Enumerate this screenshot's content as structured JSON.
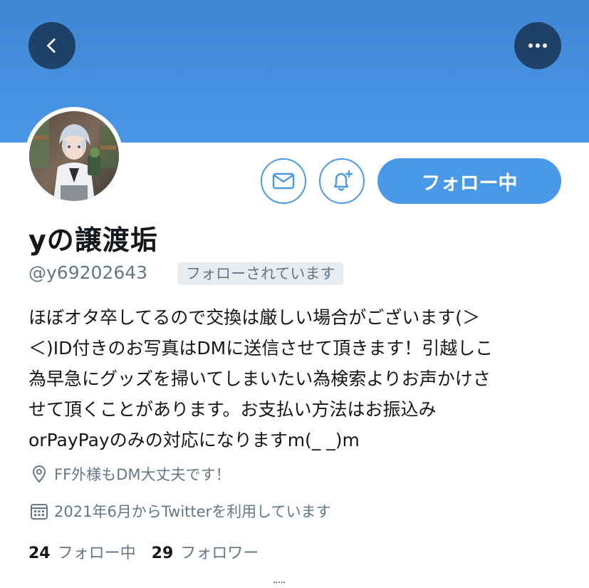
{
  "header": {
    "back_icon": "chevron-left-icon",
    "more_icon": "more-horizontal-icon",
    "banner_color": "#4a97e6"
  },
  "profile": {
    "display_name": "yの譲渡垢",
    "handle": "@y69202643",
    "follows_you_badge": "フォローされています",
    "bio": "ほぼオタ卒してるので交換は厳しい場合がございます(＞\n＜)ID付きのお写真はDMに送信させて頂きます！引越しこ\n為早急にグッズを掃いてしまいたい為検索よりお声かけさ\nせて頂くことがあります。お支払い方法はお振込み\norPayPayのみの対応になりますm(_ _)m",
    "location": "FF外様もDM大丈夫です！",
    "joined": "2021年6月からTwitterを利用しています"
  },
  "actions": {
    "dm_icon": "envelope-icon",
    "notify_icon": "bell-plus-icon",
    "follow_label": "フォロー中",
    "accent_color": "#4a99e9"
  },
  "stats": {
    "following_count": "24",
    "following_label": "フォロー中",
    "followers_count": "29",
    "followers_label": "フォロワー"
  }
}
